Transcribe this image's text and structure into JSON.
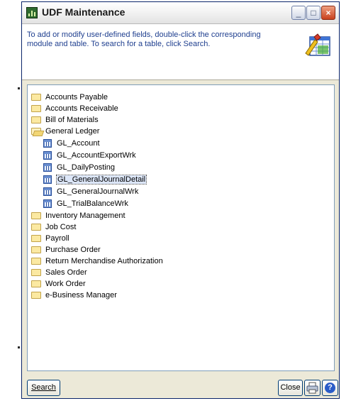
{
  "window": {
    "title": "UDF Maintenance",
    "controls": {
      "minimize": "_",
      "maximize": "□",
      "close": "×"
    }
  },
  "header": {
    "instructions": "To add or modify user-defined fields, double-click the corresponding module and table. To search for a table, click Search.",
    "icon": "wizard-icon"
  },
  "tree": {
    "modules_before": [
      "Accounts Payable",
      "Accounts Receivable",
      "Bill of Materials"
    ],
    "expanded_module": "General Ledger",
    "tables": [
      "GL_Account",
      "GL_AccountExportWrk",
      "GL_DailyPosting",
      "GL_GeneralJournalDetail",
      "GL_GeneralJournalWrk",
      "GL_TrialBalanceWrk"
    ],
    "selected_table": "GL_GeneralJournalDetail",
    "modules_after": [
      "Inventory Management",
      "Job Cost",
      "Payroll",
      "Purchase Order",
      "Return Merchandise Authorization",
      "Sales Order",
      "Work Order",
      "e-Business Manager"
    ]
  },
  "footer": {
    "search_label": "Search",
    "close_label": "Close",
    "print_icon": "printer-icon",
    "help_icon": "help-icon"
  },
  "colors": {
    "instructions_text": "#1f3f8f",
    "tree_border": "#7f9db9",
    "selection": "#dce6f8"
  }
}
